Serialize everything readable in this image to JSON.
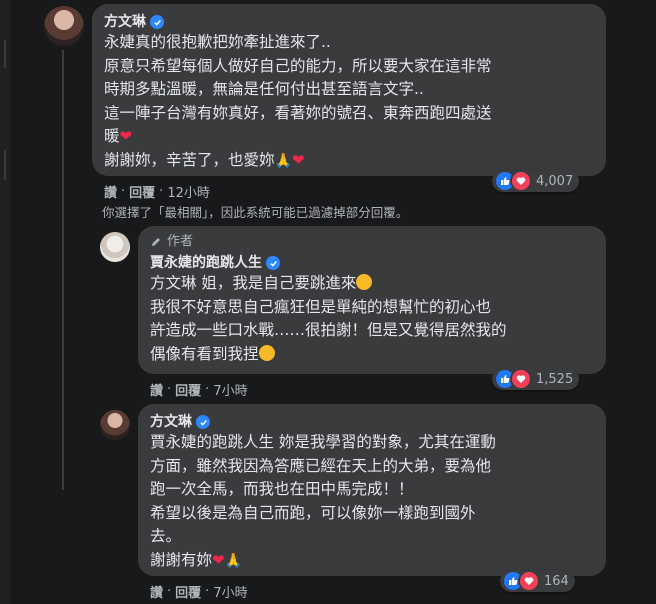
{
  "comments": [
    {
      "name": "方文琳",
      "lines": [
        "永婕真的很抱歉把妳牽扯進來了..",
        "原意只希望每個人做好自己的能力，所以要大家在這非常",
        "時期多點溫暖，無論是任何付出甚至語言文字..",
        "這一陣子台灣有妳真好，看著妳的號召、東奔西跑四處送",
        "暖",
        "謝謝妳，辛苦了，也愛妳"
      ],
      "like_label": "讚",
      "reply_label": "回覆",
      "time": "12小時",
      "reaction_count": "4,007"
    },
    {
      "author_badge": "作者",
      "name": "賈永婕的跑跳人生",
      "lines": [
        "方文琳 姐，我是自己要跳進來",
        "我很不好意思自己瘋狂但是單純的想幫忙的初心也",
        "許造成一些口水戰……很拍謝！但是又覺得居然我的",
        "偶像有看到我捏"
      ],
      "like_label": "讚",
      "reply_label": "回覆",
      "time": "7小時",
      "reaction_count": "1,525"
    },
    {
      "name": "方文琳",
      "lines": [
        "賈永婕的跑跳人生 妳是我學習的對象，尤其在運動",
        "方面，雖然我因為答應已經在天上的大弟，要為他",
        "跑一次全馬，而我也在田中馬完成！！",
        "希望以後是為自己而跑，可以像妳一樣跑到國外",
        "去。",
        "謝謝有妳"
      ],
      "like_label": "讚",
      "reply_label": "回覆",
      "time": "7小時",
      "reaction_count": "164"
    }
  ],
  "filter_note": "你選擇了「最相關」，因此系統可能已過濾掉部分回覆。",
  "separator": "·",
  "colors": {
    "bubble": "#3a3b3c",
    "background": "#18191a",
    "accent": "#2d88ff",
    "like": "#2078f4",
    "love": "#f33e58"
  },
  "icons": [
    "verified-badge-icon",
    "pencil-icon",
    "like-reaction-icon",
    "love-reaction-icon",
    "heart-emoji",
    "pray-emoji",
    "grin-emoji",
    "kiss-emoji"
  ]
}
